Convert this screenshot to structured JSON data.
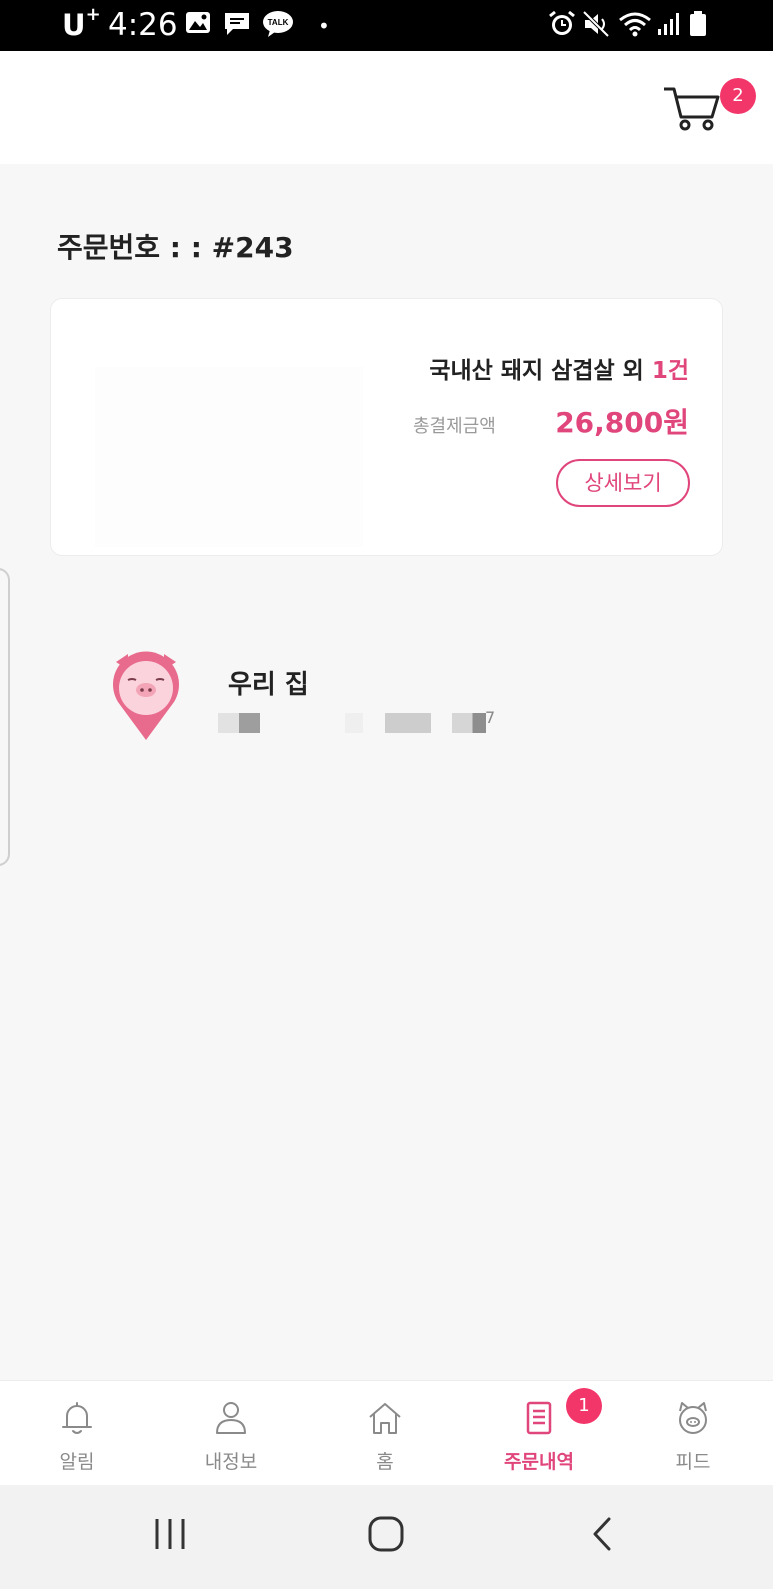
{
  "status_bar": {
    "carrier": "U",
    "carrier_sup": "+",
    "time": "4:26"
  },
  "header": {
    "cart_count": "2"
  },
  "order": {
    "number_text": "주문번호 : : #243",
    "product_name": "국내산 돼지 삼겹살 외 ",
    "product_extra": "1건",
    "total_label": "총결제금액",
    "total_amount": "26,800원",
    "detail_button": "상세보기"
  },
  "address": {
    "title": "우리 집",
    "digit": "7"
  },
  "bottom_nav": {
    "items": [
      {
        "label": "알림",
        "icon": "bell-icon"
      },
      {
        "label": "내정보",
        "icon": "person-icon"
      },
      {
        "label": "홈",
        "icon": "home-icon"
      },
      {
        "label": "주문내역",
        "icon": "receipt-icon"
      },
      {
        "label": "피드",
        "icon": "pig-face-icon"
      }
    ],
    "active_index": 3,
    "orders_badge": "1"
  },
  "colors": {
    "accent": "#e0457b",
    "badge": "#f3366a"
  }
}
